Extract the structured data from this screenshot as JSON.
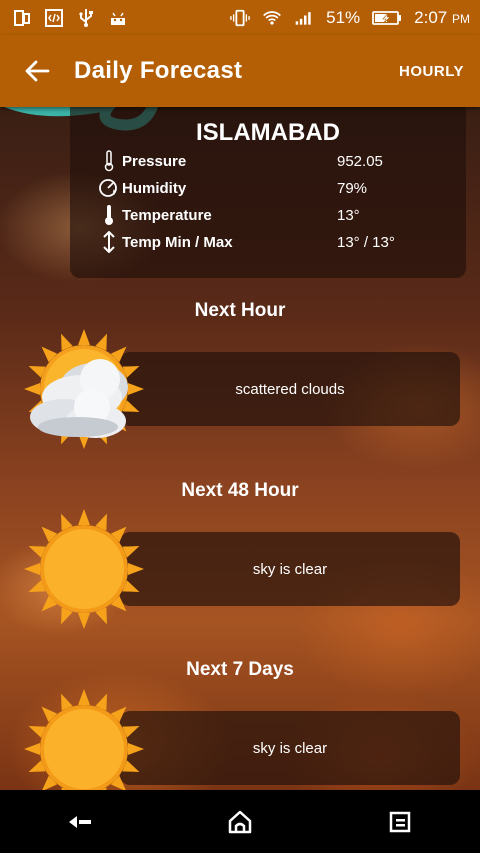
{
  "status_bar": {
    "battery_percent": "51%",
    "time": "2:07",
    "ampm": "PM",
    "icons": [
      "screen-icon",
      "code-icon",
      "usb-icon",
      "android-icon",
      "vibrate-icon",
      "wifi-icon",
      "signal-icon",
      "battery-charging-icon"
    ]
  },
  "app_bar": {
    "title": "Daily Forecast",
    "action": "HOURLY",
    "back_icon": "arrow-back-icon"
  },
  "current": {
    "city": "ISLAMABAD",
    "rows": [
      {
        "icon": "thermometer-icon",
        "label": "Pressure",
        "value": "952.05"
      },
      {
        "icon": "humidity-icon",
        "label": "Humidity",
        "value": "79%"
      },
      {
        "icon": "thermometer-icon",
        "label": "Temperature",
        "value": "13°"
      },
      {
        "icon": "up-down-arrow-icon",
        "label": "Temp Min / Max",
        "value": "13° / 13°"
      }
    ]
  },
  "forecasts": [
    {
      "title": "Next Hour",
      "description": "scattered clouds",
      "icon": "sun-clouds-icon"
    },
    {
      "title": "Next 48 Hour",
      "description": "sky is clear",
      "icon": "sun-icon"
    },
    {
      "title": "Next 7 Days",
      "description": "sky is clear",
      "icon": "sun-icon"
    }
  ],
  "colors": {
    "app_bar": "#b45f06",
    "accent_teal": "#3bb3a6",
    "sun": "#f6a21a"
  },
  "nav_bar": {
    "icons": [
      "back-nav-icon",
      "home-nav-icon",
      "recents-nav-icon"
    ]
  }
}
